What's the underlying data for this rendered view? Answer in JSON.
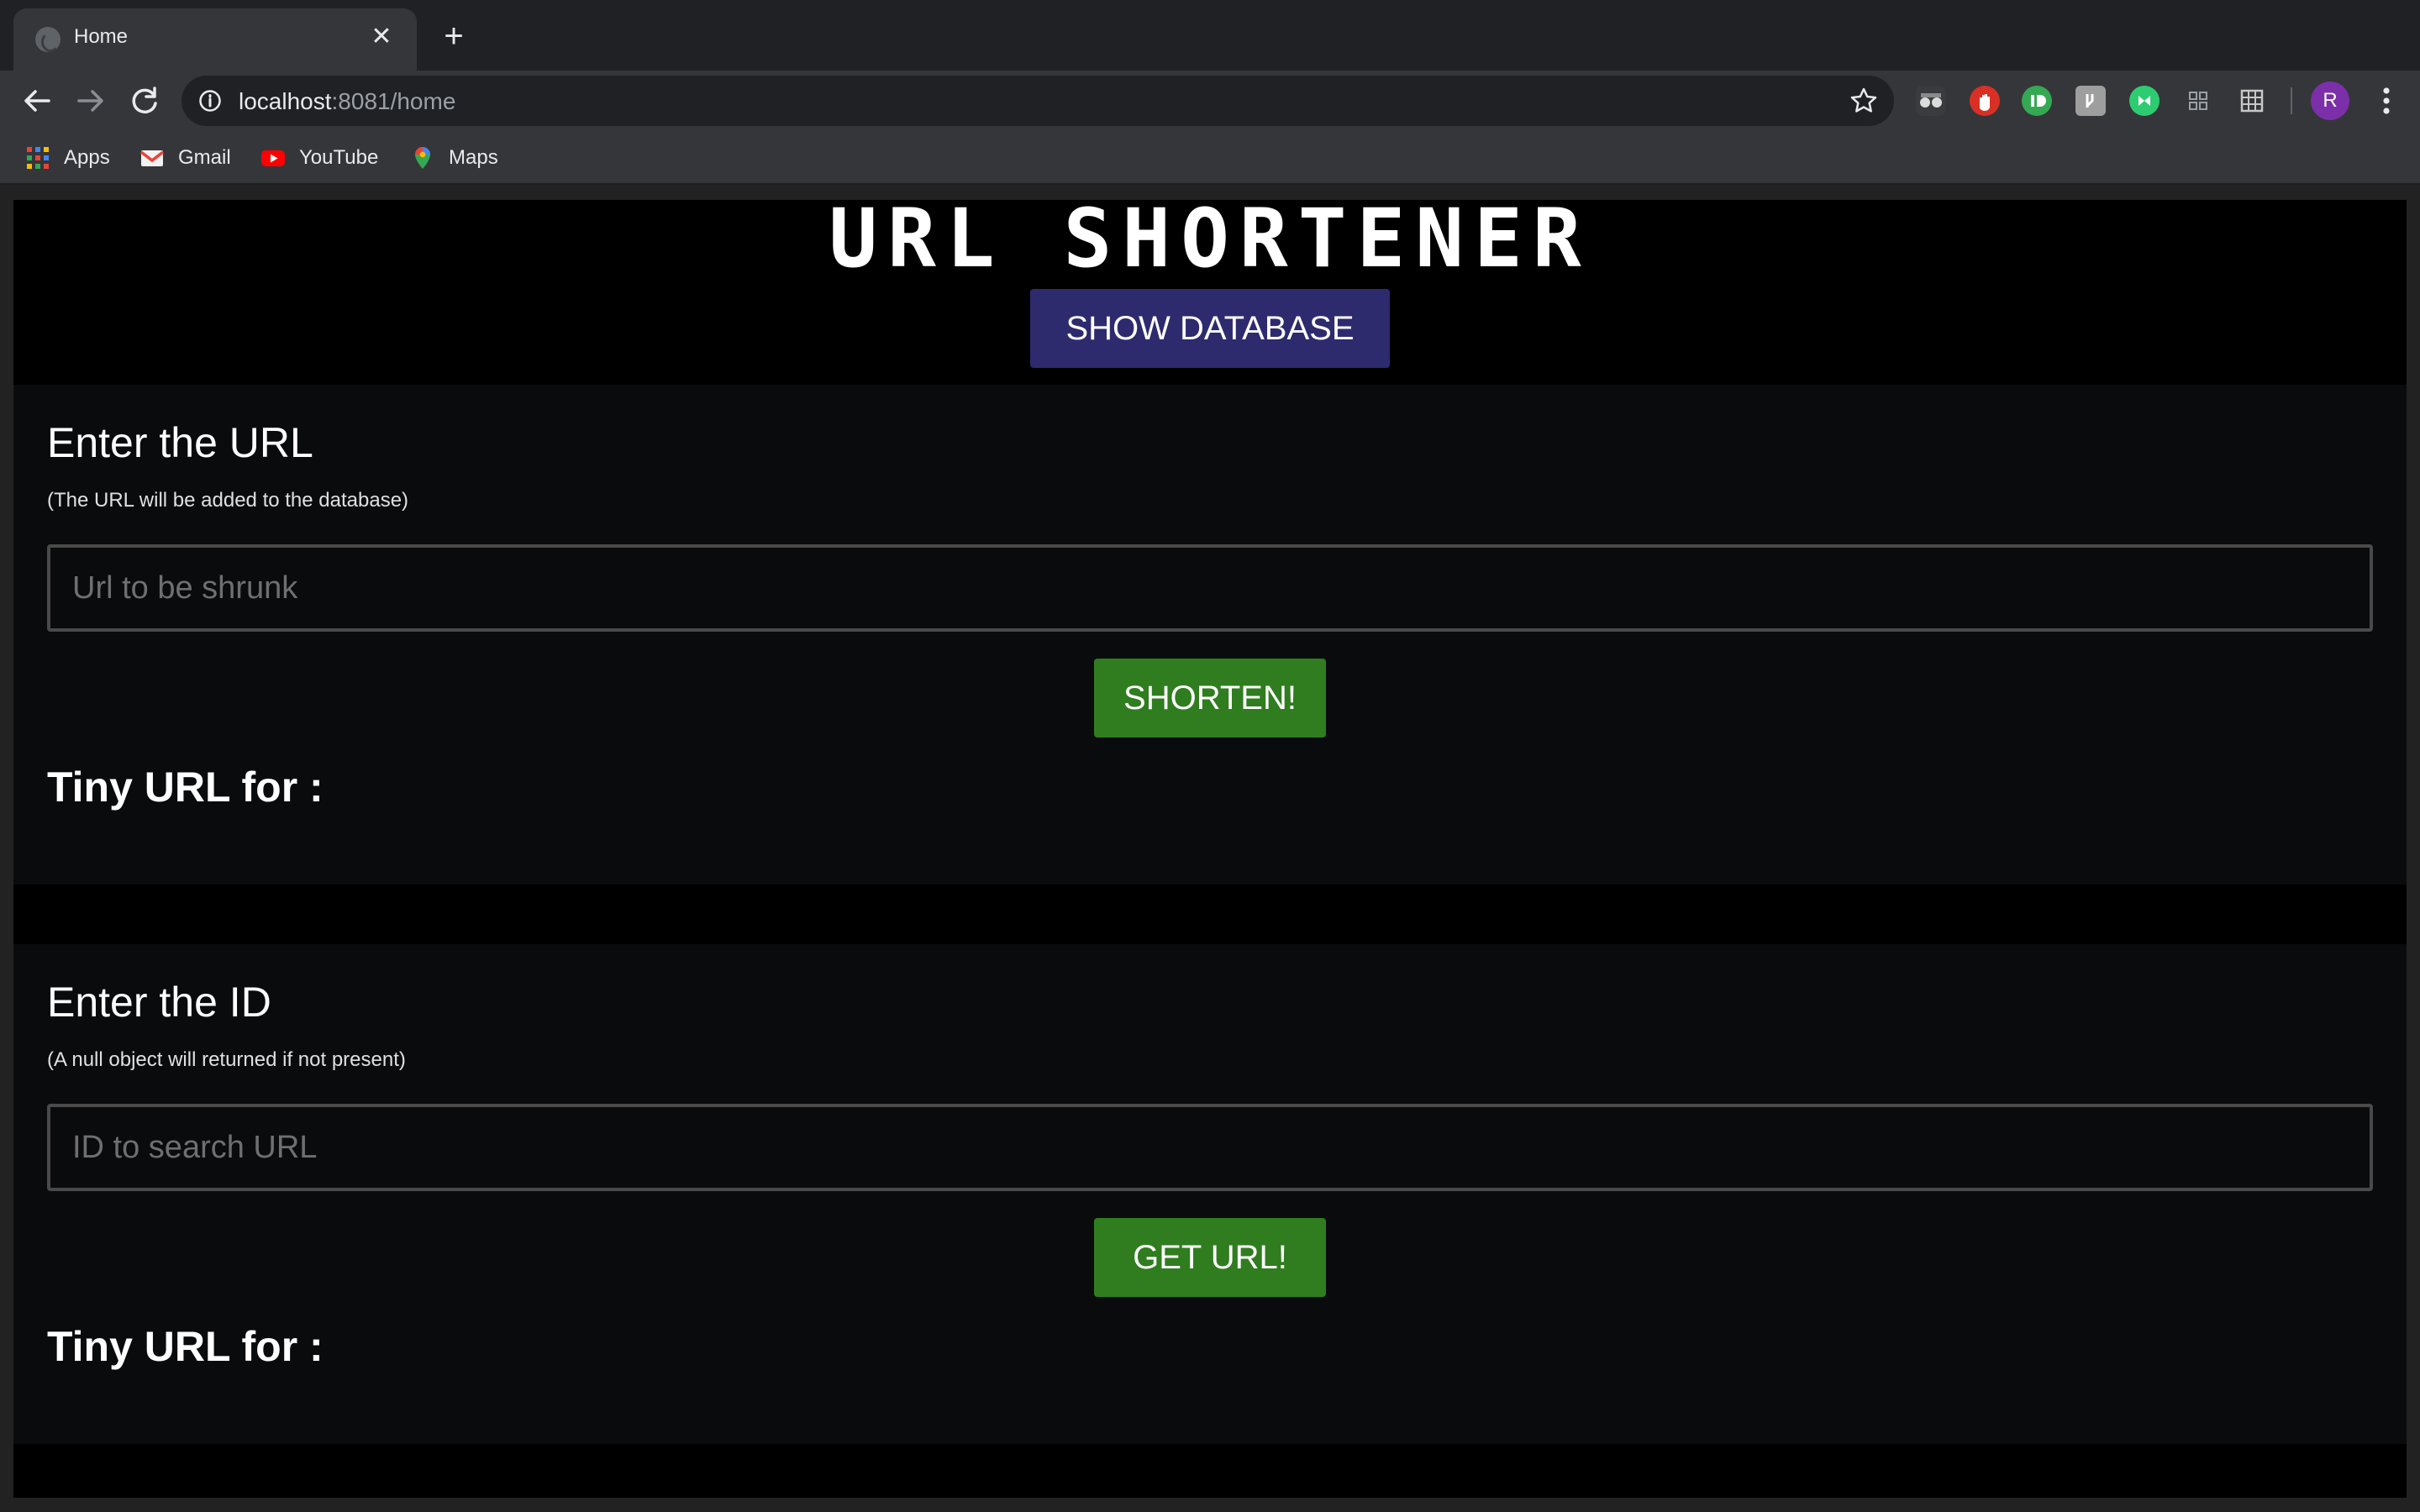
{
  "browser": {
    "tab_title": "Home",
    "url_host": "localhost",
    "url_path": ":8081/home",
    "bookmarks": [
      {
        "label": "Apps",
        "icon": "apps-grid-icon"
      },
      {
        "label": "Gmail",
        "icon": "gmail-icon"
      },
      {
        "label": "YouTube",
        "icon": "youtube-icon"
      },
      {
        "label": "Maps",
        "icon": "maps-icon"
      }
    ],
    "profile_initial": "R"
  },
  "page": {
    "title": "URL SHORTENER",
    "show_db_label": "SHOW DATABASE",
    "url_card": {
      "heading": "Enter the URL",
      "hint": "(The URL will be added to the database)",
      "placeholder": "Url to be shrunk",
      "button": "SHORTEN!",
      "result": "Tiny URL for :"
    },
    "id_card": {
      "heading": "Enter the ID",
      "hint": "(A null object will returned if not present)",
      "placeholder": "ID to search URL",
      "button": "GET URL!",
      "result": "Tiny URL for :"
    }
  },
  "colors": {
    "show_db_button": "#2e2a6e",
    "action_button": "#2f7d1f",
    "card_background": "#0a0b0d"
  }
}
